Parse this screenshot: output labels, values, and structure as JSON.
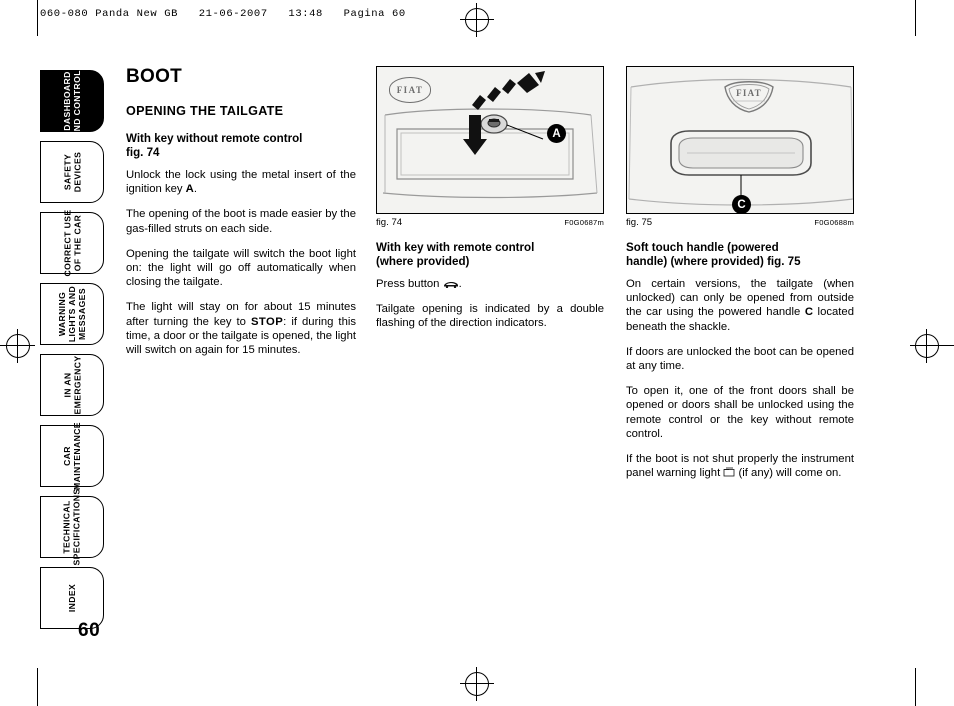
{
  "header": {
    "slug": "060-080 Panda New GB   21-06-2007   13:48   Pagina 60"
  },
  "sidebar": {
    "tabs": [
      {
        "label": "DASHBOARD\nAND CONTROLS",
        "active": true
      },
      {
        "label": "SAFETY\nDEVICES",
        "active": false
      },
      {
        "label": "CORRECT USE\nOF THE CAR",
        "active": false
      },
      {
        "label": "WARNING\nLIGHTS AND\nMESSAGES",
        "active": false
      },
      {
        "label": "IN AN\nEMERGENCY",
        "active": false
      },
      {
        "label": "CAR\nMAINTENANCE",
        "active": false
      },
      {
        "label": "TECHNICAL\nSPECIFICATIONS",
        "active": false
      },
      {
        "label": "INDEX",
        "active": false
      }
    ],
    "page_number": "60"
  },
  "column1": {
    "title": "BOOT",
    "section": "OPENING THE TAILGATE",
    "sub1_line1": "With key without remote control",
    "sub1_line2": "fig. 74",
    "p1_a": "Unlock the lock using the metal insert of the ignition key ",
    "p1_b": "A",
    "p1_c": ".",
    "p2": "The opening of the boot is made easier by the gas-filled struts on each side.",
    "p3": "Opening the tailgate will switch the boot light on: the light will go off automatically when closing the tailgate.",
    "p4_a": "The light will stay on for about 15 minutes after turning the key to  ",
    "p4_b": "STOP",
    "p4_c": ": if during this time, a door or the tailgate is opened, the light will switch on again for 15 minutes."
  },
  "column2": {
    "figure": {
      "caption_left": "fig. 74",
      "caption_right": "F0G0687m",
      "callout": "A",
      "logo": "FIAT"
    },
    "sub1_line1": "With key with remote control",
    "sub1_line2": "(where provided)",
    "p1_a": "Press button ",
    "p1_icon": "boot-release-key-icon",
    "p1_b": ".",
    "p2": "Tailgate opening is indicated by a double flashing of the direction indicators."
  },
  "column3": {
    "figure": {
      "caption_left": "fig. 75",
      "caption_right": "F0G0688m",
      "callout": "C",
      "logo": "FIAT"
    },
    "sub1_line1": "Soft touch handle (powered",
    "sub1_line2": "handle) (where provided) fig. 75",
    "p1_a": "On certain versions, the tailgate (when unlocked) can only be opened from outside the car using the powered handle ",
    "p1_b": "C",
    "p1_c": " located beneath the shackle.",
    "p2": "If doors are unlocked the boot can be opened at any time.",
    "p3": "To open it, one of the front doors shall be opened or doors shall be unlocked using the remote control or the key without remote control.",
    "p4_a": "If the boot is not shut properly the instrument panel warning light ",
    "p4_icon": "boot-open-warning-icon",
    "p4_b": " (if any) will come on."
  }
}
